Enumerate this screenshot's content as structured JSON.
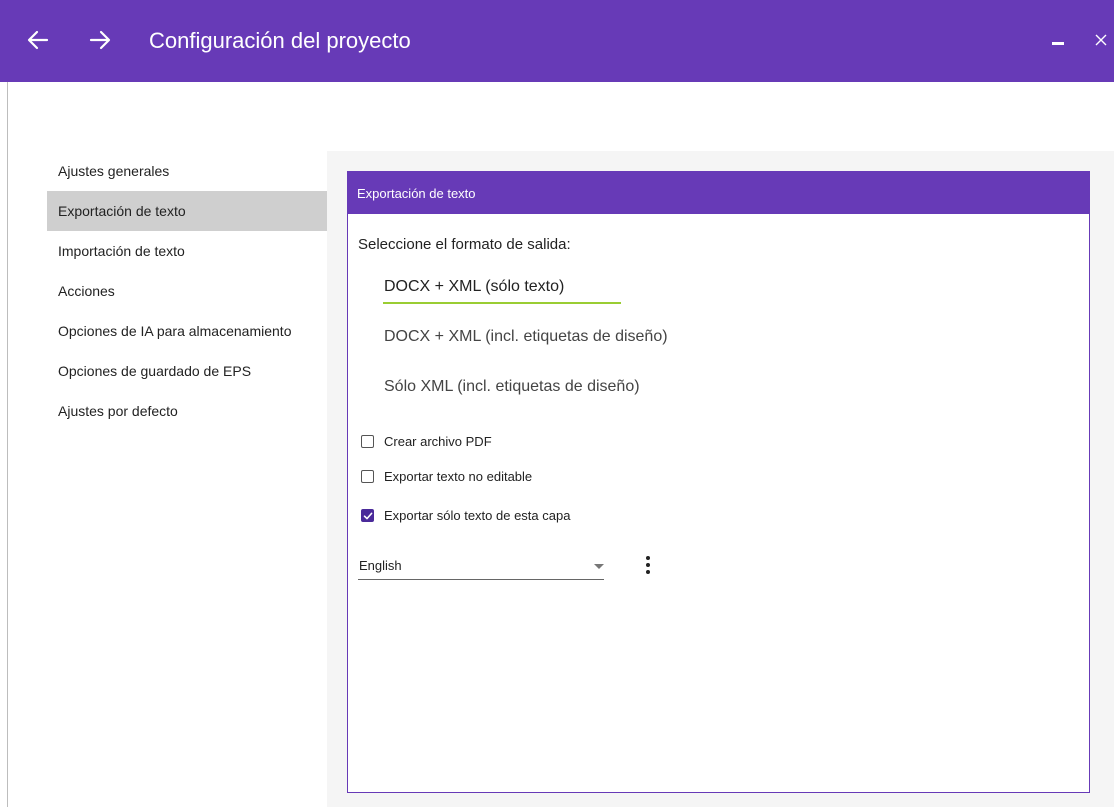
{
  "window": {
    "title": "Configuración del proyecto"
  },
  "sidebar": {
    "items": [
      {
        "label": "Ajustes generales"
      },
      {
        "label": "Exportación de texto"
      },
      {
        "label": "Importación de texto"
      },
      {
        "label": "Acciones"
      },
      {
        "label": "Opciones de IA para almacenamiento"
      },
      {
        "label": "Opciones de guardado de EPS"
      },
      {
        "label": "Ajustes por defecto"
      }
    ],
    "active_index": 1
  },
  "panel": {
    "header": "Exportación de texto",
    "format_label": "Seleccione el formato de salida:",
    "formats": [
      {
        "label": "DOCX + XML (sólo texto)",
        "selected": true
      },
      {
        "label": "DOCX + XML (incl. etiquetas de diseño)",
        "selected": false
      },
      {
        "label": "Sólo XML (incl. etiquetas de diseño)",
        "selected": false
      }
    ],
    "checkboxes": [
      {
        "label": "Crear archivo PDF",
        "checked": false
      },
      {
        "label": "Exportar texto no editable",
        "checked": false
      },
      {
        "label": "Exportar sólo texto de esta capa",
        "checked": true
      }
    ],
    "language": {
      "selected": "English"
    }
  },
  "colors": {
    "accent": "#673ab7",
    "selected_underline": "#9acd32",
    "sidebar_active": "#cfcfcf",
    "checkbox_checked": "#4a2a9a"
  },
  "icons": {
    "back": "arrow-left-icon",
    "forward": "arrow-right-icon",
    "minimize": "minimize-icon",
    "close": "close-icon",
    "more": "more-vertical-icon",
    "dropdown": "caret-down-icon",
    "check": "check-icon"
  }
}
